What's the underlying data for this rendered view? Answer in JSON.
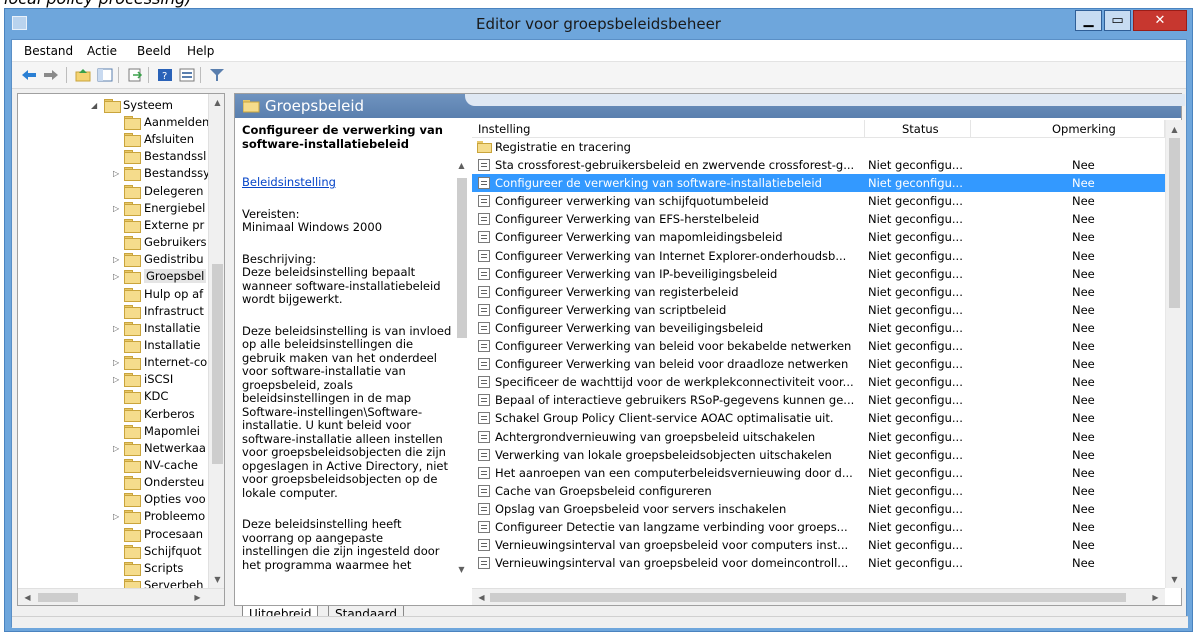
{
  "caption": "local policy processing)",
  "window": {
    "title": "Editor voor groepsbeleidsbeheer"
  },
  "menu": [
    "Bestand",
    "Actie",
    "Beeld",
    "Help"
  ],
  "toolbar": [
    "back-icon",
    "forward-icon",
    "up-folder-icon",
    "show-hide-tree-icon",
    "export-list-icon",
    "help-icon",
    "properties-icon",
    "filter-icon"
  ],
  "tree": {
    "parent": "Systeem",
    "items": [
      {
        "label": "Aanmelden",
        "expandable": false
      },
      {
        "label": "Afsluiten",
        "expandable": false
      },
      {
        "label": "Bestandssl",
        "expandable": false
      },
      {
        "label": "Bestandssy",
        "expandable": true
      },
      {
        "label": "Delegeren",
        "expandable": false
      },
      {
        "label": "Energiebel",
        "expandable": true
      },
      {
        "label": "Externe pr",
        "expandable": false
      },
      {
        "label": "Gebruikers",
        "expandable": false
      },
      {
        "label": "Gedistribu",
        "expandable": true
      },
      {
        "label": "Groepsbel",
        "expandable": true,
        "selected": true
      },
      {
        "label": "Hulp op af",
        "expandable": false
      },
      {
        "label": "Infrastruct",
        "expandable": false
      },
      {
        "label": "Installatie",
        "expandable": true
      },
      {
        "label": "Installatie",
        "expandable": false
      },
      {
        "label": "Internet-co",
        "expandable": true
      },
      {
        "label": "iSCSI",
        "expandable": true
      },
      {
        "label": "KDC",
        "expandable": false
      },
      {
        "label": "Kerberos",
        "expandable": false
      },
      {
        "label": "Mapomlei",
        "expandable": false
      },
      {
        "label": "Netwerkaa",
        "expandable": true
      },
      {
        "label": "NV-cache",
        "expandable": false
      },
      {
        "label": "Ondersteu",
        "expandable": false
      },
      {
        "label": "Opties voo",
        "expandable": false
      },
      {
        "label": "Probleemo",
        "expandable": true
      },
      {
        "label": "Procesaan",
        "expandable": false
      },
      {
        "label": "Schijfquot",
        "expandable": false
      },
      {
        "label": "Scripts",
        "expandable": false
      },
      {
        "label": "Serverbeh",
        "expandable": false
      }
    ]
  },
  "pane": {
    "header": "Groepsbeleid",
    "desc_title": "Configureer de verwerking van software-installatiebeleid",
    "desc_link": "Beleidsinstelling",
    "requires_label": "Vereisten:",
    "requires_value": "Minimaal Windows 2000",
    "desc_label": "Beschrijving:",
    "desc_p1": "Deze beleidsinstelling bepaalt wanneer software-installatiebeleid wordt bijgewerkt.",
    "desc_p2": "Deze beleidsinstelling is van invloed op alle beleidsinstellingen die gebruik maken van het onderdeel voor software-installatie van groepsbeleid, zoals beleidsinstellingen in de map Software-instellingen\\Software-installatie. U kunt beleid voor software-installatie alleen instellen voor groepsbeleidsobjecten die zijn opgeslagen in Active Directory, niet voor groepsbeleidsobjecten op de lokale computer.",
    "desc_p3": "Deze beleidsinstelling heeft voorrang op aangepaste instellingen die zijn ingesteld door het programma waarmee het"
  },
  "list": {
    "columns": [
      "Instelling",
      "Status",
      "Opmerking"
    ],
    "category": "Registratie en tracering",
    "rows": [
      {
        "setting": "Sta crossforest-gebruikersbeleid en zwervende crossforest-g...",
        "status": "Niet geconfigu...",
        "comment": "Nee"
      },
      {
        "setting": "Configureer de verwerking van software-installatiebeleid",
        "status": "Niet geconfigu...",
        "comment": "Nee",
        "selected": true
      },
      {
        "setting": "Configureer verwerking van schijfquotumbeleid",
        "status": "Niet geconfigu...",
        "comment": "Nee"
      },
      {
        "setting": "Configureer Verwerking van EFS-herstelbeleid",
        "status": "Niet geconfigu...",
        "comment": "Nee"
      },
      {
        "setting": "Configureer Verwerking van mapomleidingsbeleid",
        "status": "Niet geconfigu...",
        "comment": "Nee"
      },
      {
        "setting": "Configureer Verwerking van Internet Explorer-onderhoudsb...",
        "status": "Niet geconfigu...",
        "comment": "Nee"
      },
      {
        "setting": "Configureer Verwerking van IP-beveiligingsbeleid",
        "status": "Niet geconfigu...",
        "comment": "Nee"
      },
      {
        "setting": "Configureer Verwerking van registerbeleid",
        "status": "Niet geconfigu...",
        "comment": "Nee"
      },
      {
        "setting": "Configureer Verwerking van scriptbeleid",
        "status": "Niet geconfigu...",
        "comment": "Nee"
      },
      {
        "setting": "Configureer Verwerking van beveiligingsbeleid",
        "status": "Niet geconfigu...",
        "comment": "Nee"
      },
      {
        "setting": "Configureer Verwerking van beleid voor bekabelde netwerken",
        "status": "Niet geconfigu...",
        "comment": "Nee"
      },
      {
        "setting": "Configureer Verwerking van beleid voor draadloze netwerken",
        "status": "Niet geconfigu...",
        "comment": "Nee"
      },
      {
        "setting": "Specificeer de wachttijd voor de werkplekconnectiviteit voor...",
        "status": "Niet geconfigu...",
        "comment": "Nee"
      },
      {
        "setting": "Bepaal of interactieve gebruikers RSoP-gegevens kunnen ge...",
        "status": "Niet geconfigu...",
        "comment": "Nee"
      },
      {
        "setting": "Schakel Group Policy Client-service AOAC optimalisatie uit.",
        "status": "Niet geconfigu...",
        "comment": "Nee"
      },
      {
        "setting": "Achtergrondvernieuwing van groepsbeleid uitschakelen",
        "status": "Niet geconfigu...",
        "comment": "Nee"
      },
      {
        "setting": "Verwerking van lokale groepsbeleidsobjecten uitschakelen",
        "status": "Niet geconfigu...",
        "comment": "Nee"
      },
      {
        "setting": "Het aanroepen van een computerbeleidsvernieuwing door d...",
        "status": "Niet geconfigu...",
        "comment": "Nee"
      },
      {
        "setting": "Cache van Groepsbeleid configureren",
        "status": "Niet geconfigu...",
        "comment": "Nee"
      },
      {
        "setting": "Opslag van Groepsbeleid voor servers inschakelen",
        "status": "Niet geconfigu...",
        "comment": "Nee"
      },
      {
        "setting": "Configureer Detectie van langzame verbinding voor groeps...",
        "status": "Niet geconfigu...",
        "comment": "Nee"
      },
      {
        "setting": "Vernieuwingsinterval van groepsbeleid voor computers inst...",
        "status": "Niet geconfigu...",
        "comment": "Nee"
      },
      {
        "setting": "Vernieuwingsinterval van groepsbeleid voor domeincontroll...",
        "status": "Niet geconfigu...",
        "comment": "Nee"
      }
    ]
  },
  "tabs": [
    "Uitgebreid",
    "Standaard"
  ],
  "colors": {
    "selection": "#3399ff",
    "titlebar": "#6ea6dc",
    "header": "#5a7fae",
    "link": "#0645c8"
  }
}
